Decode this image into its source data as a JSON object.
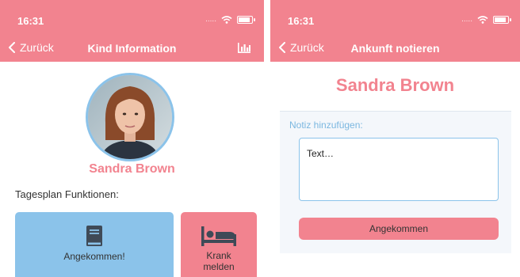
{
  "left_screen": {
    "status": {
      "time": "16:31",
      "signal": "....."
    },
    "nav": {
      "back_label": "Zurück",
      "title": "Kind Information",
      "right_icon": "bar-chart-icon"
    },
    "avatar_icon": "child-photo",
    "child_name": "Sandra Brown",
    "section_label": "Tagesplan Funktionen:",
    "tiles": [
      {
        "icon": "book-icon",
        "label": "Angekommen!",
        "color": "#8bc3ea"
      },
      {
        "icon": "bed-icon",
        "label_line1": "Krank",
        "label_line2": "melden",
        "color": "#f2838f"
      }
    ]
  },
  "right_screen": {
    "status": {
      "time": "16:31",
      "signal": "....."
    },
    "nav": {
      "back_label": "Zurück",
      "title": "Ankunft notieren"
    },
    "child_name": "Sandra Brown",
    "note_label": "Notiz hinzufügen:",
    "note_placeholder": "Text…",
    "submit_label": "Angekommen"
  },
  "colors": {
    "header": "#f2838f",
    "accent_blue": "#8bc3ea",
    "accent_pink": "#f2838f"
  }
}
